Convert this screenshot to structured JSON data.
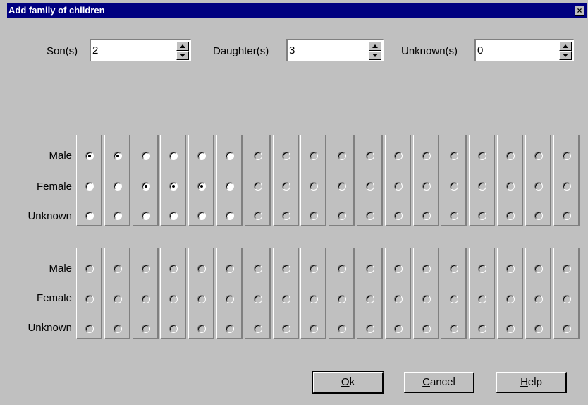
{
  "window": {
    "title": "Add family of children",
    "close_label": "×"
  },
  "counts": {
    "sons": {
      "label": "Son(s)",
      "value": "2"
    },
    "daughters": {
      "label": "Daughter(s)",
      "value": "3"
    },
    "unknowns": {
      "label": "Unknown(s)",
      "value": "0"
    }
  },
  "row_labels": [
    "Male",
    "Female",
    "Unknown"
  ],
  "groups": [
    {
      "columns": 18,
      "selections": [
        "Male",
        "Male",
        "Female",
        "Female",
        "Female"
      ],
      "enabled_columns": 6
    },
    {
      "columns": 18,
      "selections": [],
      "enabled_columns": 0
    }
  ],
  "buttons": {
    "ok": {
      "mnemonic": "O",
      "rest": "k"
    },
    "cancel": {
      "mnemonic": "C",
      "rest": "ancel"
    },
    "help": {
      "mnemonic": "H",
      "rest": "elp"
    }
  }
}
